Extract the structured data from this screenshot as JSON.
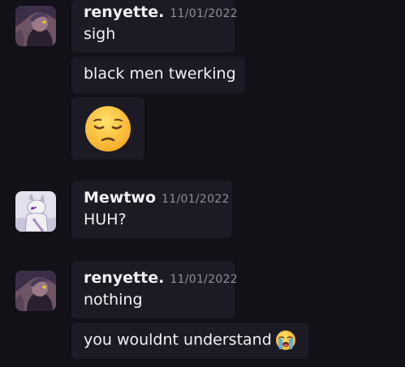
{
  "messages": [
    {
      "author": "renyette.",
      "timestamp": "11/01/2022",
      "lines": [
        "sigh",
        "black men twerking"
      ],
      "emoji": "pensive-face"
    },
    {
      "author": "Mewtwo",
      "timestamp": "11/01/2022",
      "lines": [
        "HUH?"
      ]
    },
    {
      "author": "renyette.",
      "timestamp": "11/01/2022",
      "lines": [
        "nothing",
        "you wouldnt understand"
      ],
      "inline_emoji": "loudly-crying-face"
    }
  ],
  "colors": {
    "background": "#111117",
    "bubble": "#1c1b25",
    "text": "#f2f2f5",
    "timestamp": "#8e8e99"
  }
}
